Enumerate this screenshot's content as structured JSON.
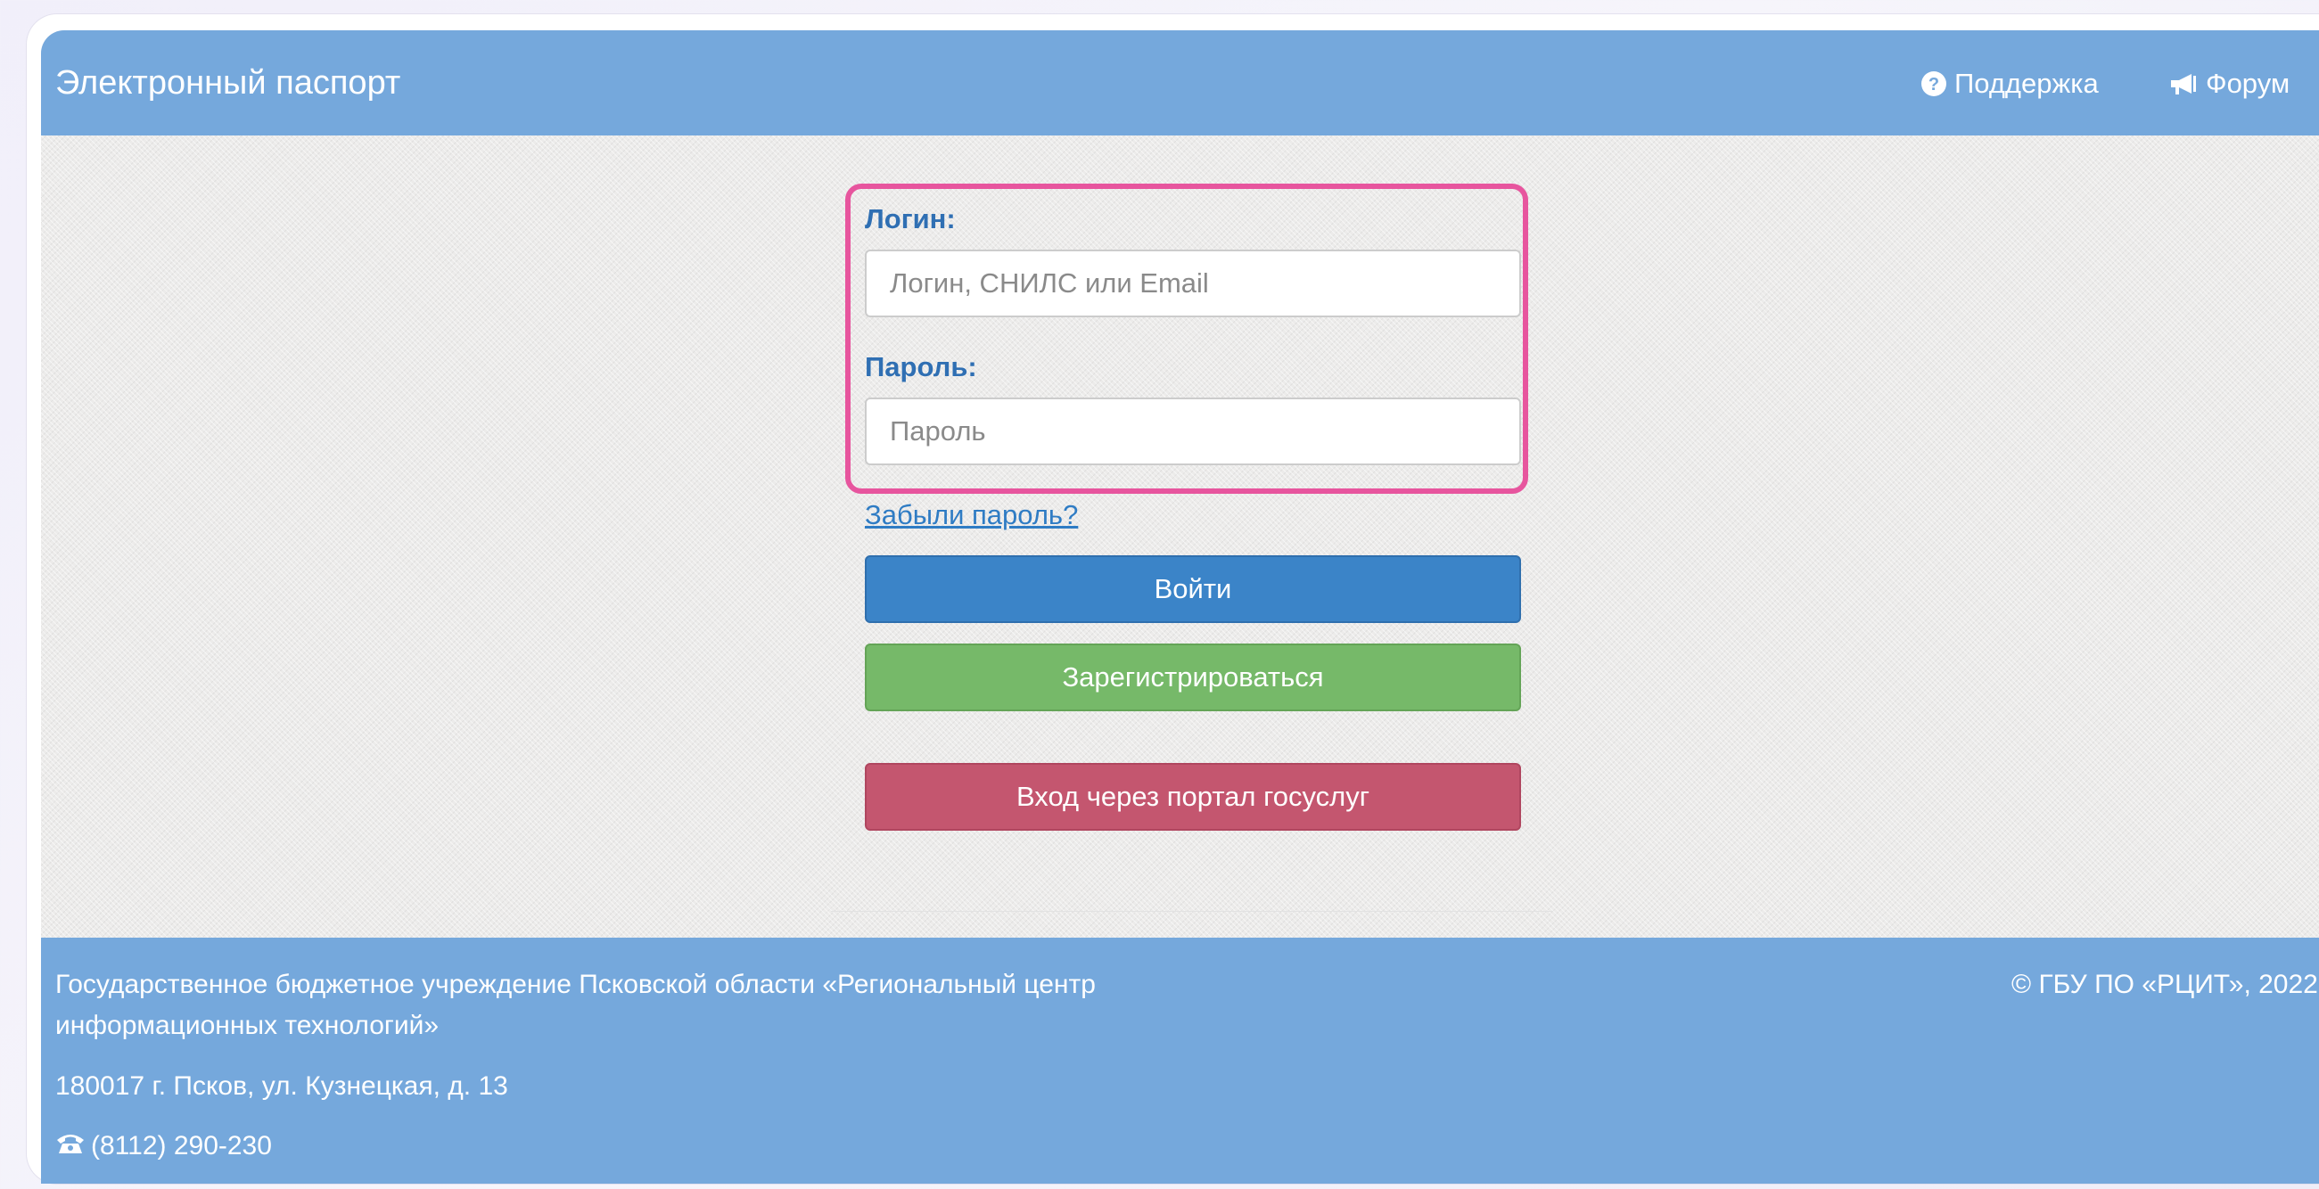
{
  "navbar": {
    "brand": "Электронный паспорт",
    "links": [
      {
        "label": "Поддержка",
        "icon": "question-circle-icon"
      },
      {
        "label": "Форум",
        "icon": "bullhorn-icon"
      }
    ]
  },
  "login": {
    "login_label": "Логин:",
    "login_placeholder": "Логин, СНИЛС или Email",
    "login_value": "",
    "password_label": "Пароль:",
    "password_placeholder": "Пароль",
    "password_value": "",
    "forgot_link": "Забыли пароль?",
    "submit_label": "Войти",
    "register_label": "Зарегистрироваться",
    "gosuslugi_label": "Вход через портал госуслуг"
  },
  "footer": {
    "organization": "Государственное бюджетное учреждение Псковской области «Региональный центр информационных технологий»",
    "copyright": "© ГБУ ПО «РЦИТ», 2022",
    "address": "180017 г. Псков, ул. Кузнецкая, д. 13",
    "phone": "(8112) 290-230",
    "phone_icon": "phone-icon"
  },
  "colors": {
    "header_bg": "#75a8dc",
    "label": "#2f6fb3",
    "primary_button": "#3b84c8",
    "success_button": "#76b969",
    "danger_button": "#c4566f",
    "highlight_border": "#e7559e"
  }
}
